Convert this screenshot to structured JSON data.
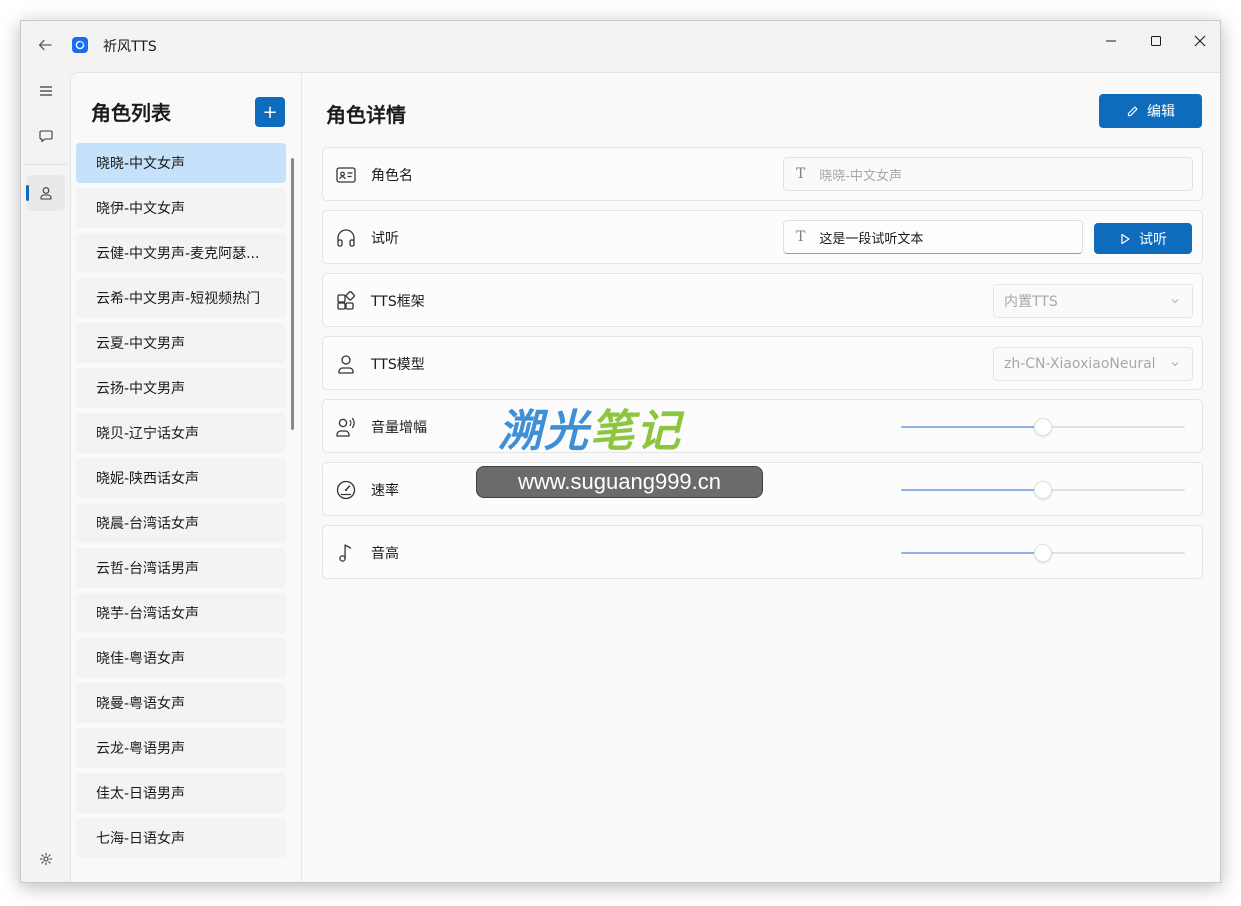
{
  "window": {
    "title": "祈风TTS"
  },
  "nav": {
    "items": [
      {
        "name": "menu",
        "icon": "hamburger-menu-icon"
      },
      {
        "name": "chat",
        "icon": "chat-bubble-icon"
      },
      {
        "name": "roles",
        "icon": "person-icon",
        "active": true
      }
    ],
    "settings_icon": "gear-icon"
  },
  "role_list": {
    "title": "角色列表",
    "add_label": "+",
    "items": [
      "晓晓-中文女声",
      "晓伊-中文女声",
      "云健-中文男声-麦克阿瑟...",
      "云希-中文男声-短视频热门",
      "云夏-中文男声",
      "云扬-中文男声",
      "晓贝-辽宁话女声",
      "晓妮-陕西话女声",
      "晓晨-台湾话女声",
      "云哲-台湾话男声",
      "晓芋-台湾话女声",
      "晓佳-粤语女声",
      "晓曼-粤语女声",
      "云龙-粤语男声",
      "佳太-日语男声",
      "七海-日语女声"
    ],
    "selected_index": 0
  },
  "detail": {
    "title": "角色详情",
    "edit_label": "编辑",
    "fields": {
      "name": {
        "label": "角色名",
        "placeholder": "晓晓-中文女声"
      },
      "preview": {
        "label": "试听",
        "value": "这是一段试听文本",
        "button_label": "试听"
      },
      "framework": {
        "label": "TTS框架",
        "selected": "内置TTS"
      },
      "model": {
        "label": "TTS模型",
        "selected": "zh-CN-XiaoxiaoNeural"
      },
      "volume": {
        "label": "音量增幅",
        "level": 0.5
      },
      "rate": {
        "label": "速率",
        "level": 0.5
      },
      "pitch": {
        "label": "音高",
        "level": 0.5
      }
    }
  },
  "watermark": {
    "brand_blue": "溯光",
    "brand_green": "笔记",
    "url": "www.suguang999.cn"
  },
  "colors": {
    "accent": "#0f6cbd",
    "selected_item": "#c6e1fa",
    "slider_fill": "#8fb3e6",
    "brand_blue": "#3d8fd6",
    "brand_green": "#8cc63e"
  }
}
